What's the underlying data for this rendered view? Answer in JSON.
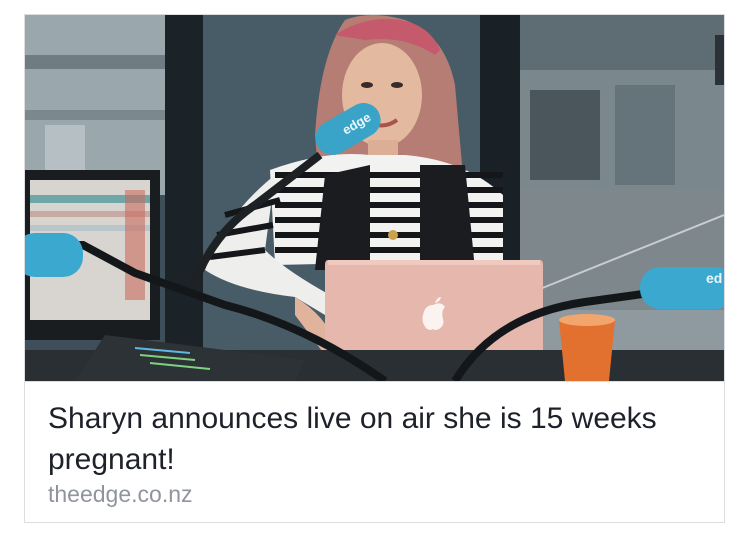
{
  "link_preview": {
    "headline": "Sharyn announces live on air she is 15 weeks pregnant!",
    "domain": "theedge.co.nz",
    "image": {
      "mic_brand": "edge",
      "laptop_logo": "apple-logo-icon"
    }
  }
}
